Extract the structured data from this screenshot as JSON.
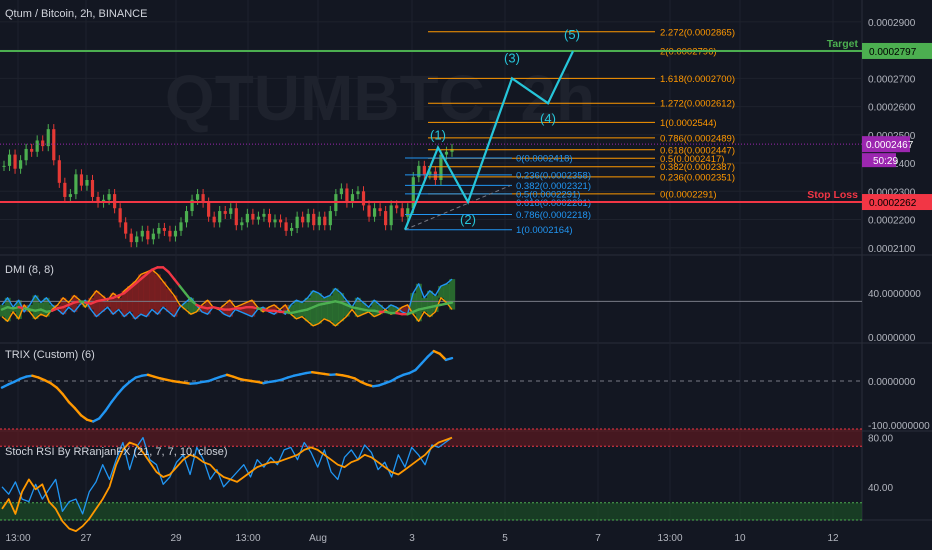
{
  "chart_data": {
    "type": "line",
    "title": "Qtum / Bitcoin, 2h, BINANCE",
    "watermark": "QTUMBTC, 2h",
    "x_ticks": [
      "13:00",
      "27",
      "29",
      "13:00",
      "Aug",
      "3",
      "5",
      "7",
      "13:00",
      "10",
      "12"
    ],
    "price_axis": {
      "ticks": [
        "0.0002900",
        "0.0002800",
        "0.0002700",
        "0.0002600",
        "0.0002500",
        "0.0002400",
        "0.0002300",
        "0.0002200",
        "0.0002100"
      ],
      "ylim": [
        0.0002085,
        0.0002935
      ]
    },
    "levels": {
      "target": {
        "label": "Target",
        "value": 0.0002797,
        "value_text": "0.0002797",
        "color": "#4caf50"
      },
      "stop": {
        "label": "Stop Loss",
        "value": 0.0002262,
        "value_text": "0.0002262",
        "color": "#f23645"
      },
      "current": {
        "value": 0.0002467,
        "value_text": "0.0002467",
        "countdown": "50:29",
        "color": "#9c27b0"
      }
    },
    "fib_up": {
      "color": "#ff9800",
      "levels": [
        {
          "value": 0.0002865,
          "text": "2.272(0.0002865)"
        },
        {
          "value": 0.0002796,
          "text": "2(0.0002796)"
        },
        {
          "value": 0.00027,
          "text": "1.618(0.0002700)"
        },
        {
          "value": 0.0002612,
          "text": "1.272(0.0002612)"
        },
        {
          "value": 0.0002544,
          "text": "1(0.0002544)"
        },
        {
          "value": 0.0002489,
          "text": "0.786(0.0002489)"
        },
        {
          "value": 0.0002447,
          "text": "0.618(0.0002447)"
        },
        {
          "value": 0.0002417,
          "text": "0.5(0.0002417)"
        },
        {
          "value": 0.0002387,
          "text": "0.382(0.0002387)"
        },
        {
          "value": 0.0002351,
          "text": "0.236(0.0002351)"
        },
        {
          "value": 0.0002291,
          "text": "0(0.0002291)"
        }
      ]
    },
    "fib_retrace": {
      "color": "#2196f3",
      "levels": [
        {
          "value": 0.0002418,
          "text": "0(0.0002418)"
        },
        {
          "value": 0.0002358,
          "text": "0.236(0.0002358)"
        },
        {
          "value": 0.0002321,
          "text": "0.382(0.0002321)"
        },
        {
          "value": 0.0002291,
          "text": "0.5(0.0002291)"
        },
        {
          "value": 0.0002261,
          "text": "0.618(0.0002261)"
        },
        {
          "value": 0.0002218,
          "text": "0.786(0.0002218)"
        },
        {
          "value": 0.0002164,
          "text": "1(0.0002164)"
        }
      ]
    },
    "waves": [
      {
        "label": "(1)",
        "value": 0.0002455
      },
      {
        "label": "(2)",
        "value": 0.0002262
      },
      {
        "label": "(3)",
        "value": 0.00027
      },
      {
        "label": "(4)",
        "value": 0.0002612
      },
      {
        "label": "(5)",
        "value": 0.0002796
      }
    ],
    "candles": [
      0.000239,
      0.000243,
      0.000238,
      0.000241,
      0.000245,
      0.000244,
      0.000248,
      0.000246,
      0.000252,
      0.000241,
      0.000233,
      0.000228,
      0.000229,
      0.000236,
      0.000232,
      0.000234,
      0.000228,
      0.000226,
      0.000227,
      0.000229,
      0.000224,
      0.000219,
      0.000215,
      0.000212,
      0.000214,
      0.000216,
      0.000213,
      0.000215,
      0.000217,
      0.000216,
      0.000214,
      0.000216,
      0.000219,
      0.000223,
      0.000227,
      0.000229,
      0.000226,
      0.000221,
      0.000219,
      0.000223,
      0.000222,
      0.000224,
      0.000218,
      0.000219,
      0.000222,
      0.00022,
      0.000221,
      0.000222,
      0.000219,
      0.00022,
      0.000219,
      0.000216,
      0.000217,
      0.000221,
      0.000219,
      0.000222,
      0.000218,
      0.000221,
      0.000218,
      0.000223,
      0.000229,
      0.000231,
      0.000226,
      0.000229,
      0.00023,
      0.000225,
      0.000221,
      0.000224,
      0.000223,
      0.000218,
      0.000225,
      0.000224,
      0.000221,
      0.000224,
      0.000235,
      0.000239,
      0.000236,
      0.000237,
      0.000234,
      0.000243,
      0.000244,
      0.000245
    ],
    "dmi": {
      "title": "DMI (8, 8)",
      "ticks": [
        "40.0000000",
        "0.0000000"
      ],
      "level_line": 33,
      "plus_di": [
        30,
        36,
        28,
        34,
        24,
        30,
        38,
        32,
        36,
        30,
        26,
        22,
        28,
        24,
        30,
        34,
        26,
        20,
        24,
        28,
        22,
        26,
        20,
        24,
        18,
        22,
        20,
        26,
        22,
        28,
        24,
        20,
        28,
        32,
        36,
        30,
        24,
        22,
        28,
        26,
        22,
        20,
        26,
        24,
        22,
        20,
        26,
        28,
        24,
        22,
        26,
        22,
        30,
        34,
        32,
        36,
        42,
        40,
        36,
        38,
        44,
        40,
        34,
        28,
        36,
        32,
        28,
        34,
        30,
        26,
        30,
        28,
        24,
        22,
        40,
        48,
        36,
        42,
        38,
        46,
        48,
        52
      ],
      "minus_di": [
        20,
        16,
        24,
        18,
        30,
        24,
        18,
        22,
        20,
        26,
        30,
        36,
        32,
        38,
        34,
        28,
        36,
        42,
        38,
        34,
        40,
        36,
        42,
        46,
        50,
        56,
        58,
        60,
        56,
        50,
        44,
        38,
        30,
        26,
        22,
        24,
        30,
        34,
        28,
        26,
        30,
        34,
        28,
        30,
        32,
        34,
        28,
        24,
        28,
        30,
        26,
        30,
        22,
        18,
        20,
        16,
        12,
        14,
        18,
        16,
        12,
        16,
        20,
        26,
        20,
        22,
        24,
        20,
        22,
        26,
        22,
        24,
        28,
        30,
        22,
        16,
        24,
        20,
        24,
        36,
        32,
        26
      ],
      "adx": [
        26,
        28,
        27,
        28,
        27,
        26,
        25,
        26,
        24,
        25,
        27,
        28,
        30,
        32,
        33,
        32,
        31,
        33,
        34,
        35,
        36,
        38,
        40,
        44,
        48,
        52,
        56,
        60,
        62,
        62,
        58,
        52,
        46,
        40,
        34,
        30,
        28,
        27,
        28,
        27,
        26,
        26,
        27,
        27,
        28,
        28,
        27,
        26,
        25,
        25,
        24,
        24,
        23,
        24,
        25,
        26,
        28,
        30,
        31,
        32,
        33,
        32,
        30,
        28,
        27,
        26,
        25,
        25,
        24,
        24,
        23,
        23,
        22,
        22,
        24,
        26,
        27,
        28,
        29,
        30,
        31,
        32
      ]
    },
    "trix": {
      "title": "TRIX (Custom) (6)",
      "ticks": [
        "0.0000000",
        "-100.0000000"
      ],
      "series": [
        -15,
        -8,
        -2,
        5,
        10,
        12,
        8,
        2,
        -5,
        -15,
        -30,
        -48,
        -62,
        -78,
        -88,
        -92,
        -85,
        -68,
        -48,
        -30,
        -14,
        -2,
        8,
        12,
        14,
        10,
        6,
        3,
        0,
        -2,
        -4,
        -6,
        -5,
        -2,
        0,
        5,
        10,
        14,
        10,
        5,
        2,
        0,
        -2,
        -5,
        -2,
        0,
        3,
        8,
        12,
        15,
        18,
        20,
        18,
        16,
        14,
        15,
        13,
        10,
        6,
        -2,
        -8,
        -12,
        -10,
        -5,
        0,
        8,
        14,
        18,
        25,
        40,
        55,
        68,
        62,
        48,
        52
      ],
      "segment_colors": [
        "#2196f3",
        "#ff9800"
      ]
    },
    "stoch": {
      "title": "Stoch RSI By RRanjanFX (21, 7, 7, 10, close)",
      "ticks": [
        "80.00",
        "40.00"
      ],
      "upper": 80,
      "lower": 20,
      "k": [
        22,
        30,
        18,
        36,
        46,
        38,
        42,
        28,
        22,
        12,
        6,
        4,
        8,
        14,
        22,
        30,
        40,
        58,
        70,
        76,
        74,
        68,
        60,
        52,
        48,
        50,
        56,
        62,
        66,
        64,
        60,
        58,
        52,
        48,
        46,
        44,
        48,
        52,
        56,
        58,
        60,
        60,
        62,
        64,
        66,
        70,
        72,
        70,
        66,
        62,
        58,
        56,
        60,
        62,
        66,
        64,
        60,
        56,
        52,
        50,
        54,
        58,
        62,
        66,
        72,
        76,
        78,
        80
      ],
      "d": [
        40,
        34,
        44,
        30,
        28,
        42,
        30,
        38,
        46,
        20,
        28,
        30,
        18,
        36,
        44,
        58,
        46,
        62,
        76,
        54,
        72,
        80,
        62,
        58,
        42,
        48,
        60,
        66,
        50,
        72,
        62,
        46,
        54,
        40,
        46,
        52,
        58,
        48,
        62,
        56,
        64,
        58,
        70,
        72,
        62,
        76,
        68,
        56,
        70,
        52,
        46,
        64,
        70,
        62,
        74,
        68,
        54,
        60,
        48,
        66,
        56,
        72,
        66,
        58,
        74,
        72,
        76,
        80
      ]
    }
  }
}
